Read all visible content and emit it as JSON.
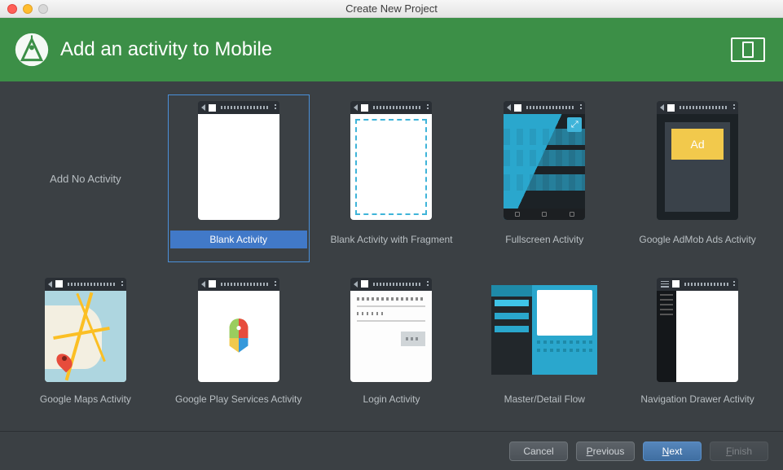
{
  "window_title": "Create New Project",
  "header_text": "Add an activity to Mobile",
  "no_activity_label": "Add No Activity",
  "admob_label": "Ad",
  "activities": {
    "blank": "Blank Activity",
    "fragment": "Blank Activity with Fragment",
    "fullscreen": "Fullscreen Activity",
    "admob": "Google AdMob Ads Activity",
    "maps": "Google Maps Activity",
    "play": "Google Play Services Activity",
    "login": "Login Activity",
    "masterdetail": "Master/Detail Flow",
    "navdrawer": "Navigation Drawer Activity"
  },
  "selected": "blank",
  "buttons": {
    "cancel": "Cancel",
    "previous": "Previous",
    "previous_u": "P",
    "next": "Next",
    "next_u": "N",
    "finish": "Finish",
    "finish_u": "F"
  }
}
